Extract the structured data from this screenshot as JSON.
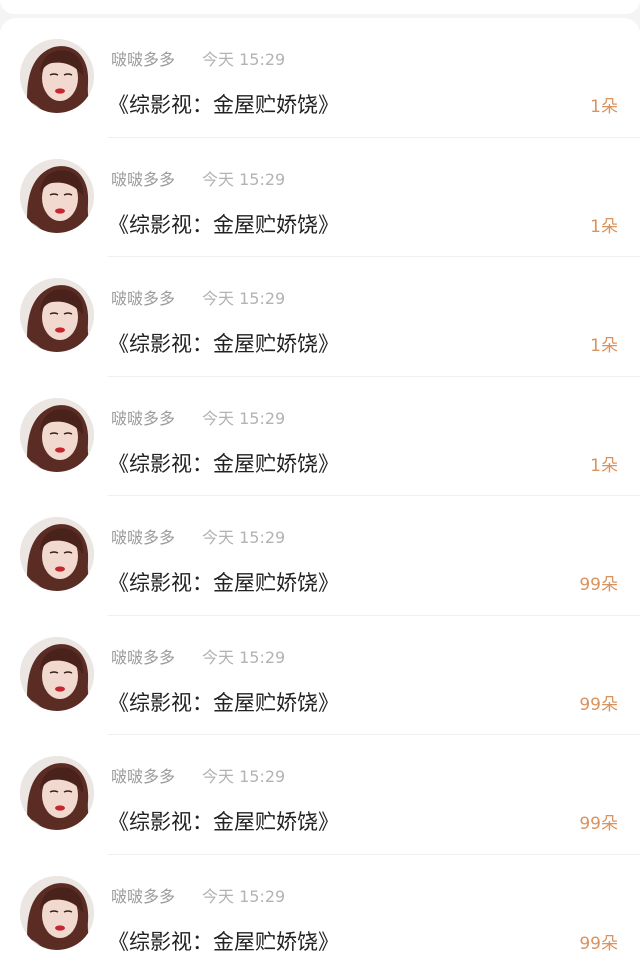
{
  "feed": {
    "items": [
      {
        "username": "啵啵多多",
        "time": "今天 15:29",
        "title": "《综影视：金屋贮娇饶》",
        "count": "1朵"
      },
      {
        "username": "啵啵多多",
        "time": "今天 15:29",
        "title": "《综影视：金屋贮娇饶》",
        "count": "1朵"
      },
      {
        "username": "啵啵多多",
        "time": "今天 15:29",
        "title": "《综影视：金屋贮娇饶》",
        "count": "1朵"
      },
      {
        "username": "啵啵多多",
        "time": "今天 15:29",
        "title": "《综影视：金屋贮娇饶》",
        "count": "1朵"
      },
      {
        "username": "啵啵多多",
        "time": "今天 15:29",
        "title": "《综影视：金屋贮娇饶》",
        "count": "99朵"
      },
      {
        "username": "啵啵多多",
        "time": "今天 15:29",
        "title": "《综影视：金屋贮娇饶》",
        "count": "99朵"
      },
      {
        "username": "啵啵多多",
        "time": "今天 15:29",
        "title": "《综影视：金屋贮娇饶》",
        "count": "99朵"
      },
      {
        "username": "啵啵多多",
        "time": "今天 15:29",
        "title": "《综影视：金屋贮娇饶》",
        "count": "99朵"
      }
    ]
  },
  "colors": {
    "count_accent": "#d9935f",
    "username": "#9c9c9c",
    "timestamp": "#b3b3b3",
    "title": "#222222"
  }
}
